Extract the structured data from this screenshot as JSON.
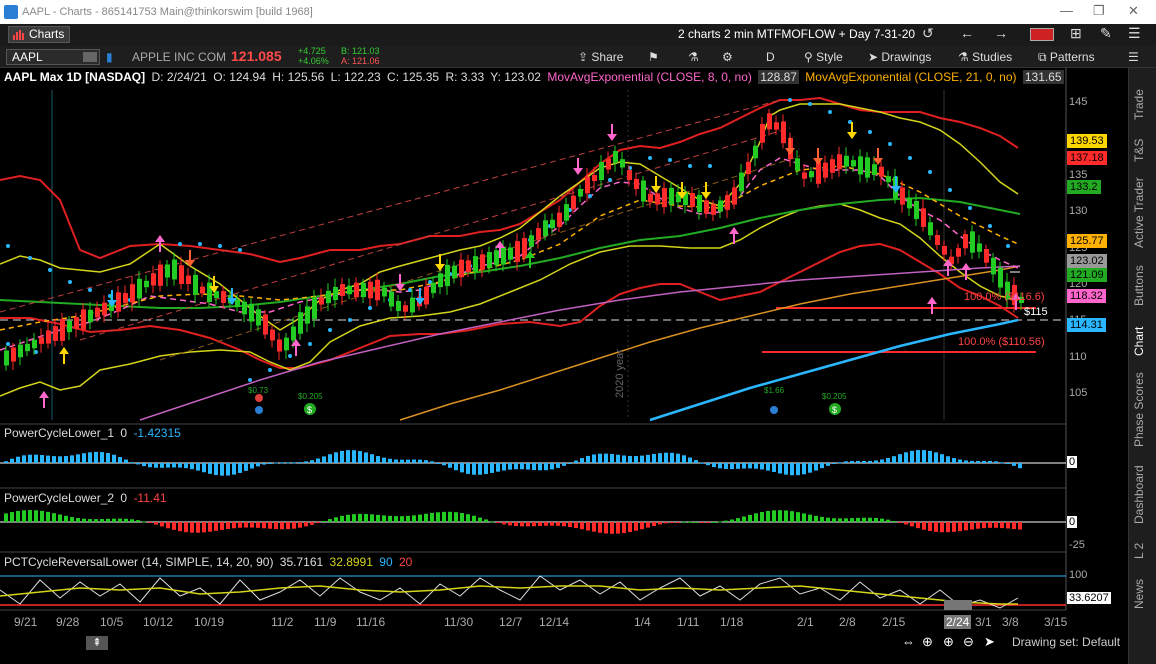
{
  "window": {
    "title": "AAPL - Charts - 865141753 Main@thinkorswim [build 1968]"
  },
  "tabbar": {
    "charts_label": "Charts",
    "layout_name": "2 charts 2 min MTFMOFLOW + Day 7-31-20"
  },
  "toolbar": {
    "symbol": "AAPL",
    "company": "APPLE INC COM",
    "last": "121.085",
    "net_change": "+4.725",
    "pct_change": "+4.06%",
    "bid": "B: 121.03",
    "ask": "A: 121.06",
    "share": "Share",
    "period": "D",
    "style": "Style",
    "drawings": "Drawings",
    "studies": "Studies",
    "patterns": "Patterns"
  },
  "header": {
    "title": "AAPL Max 1D [NASDAQ]",
    "date": "D: 2/24/21",
    "open": "O: 124.94",
    "high": "H: 125.56",
    "low": "L: 122.23",
    "close": "C: 125.35",
    "range": "R: 3.33",
    "y": "Y: 123.02",
    "ema8_label": "MovAvgExponential (CLOSE, 8, 0, no)",
    "ema8_value": "128.87",
    "ema21_label": "MovAvgExponential (CLOSE, 21, 0, no)",
    "ema21_value": "131.65"
  },
  "price_axis": {
    "ticks": [
      "145",
      "140",
      "135",
      "130",
      "125",
      "120",
      "115",
      "110",
      "105"
    ]
  },
  "price_tags": [
    {
      "value": "139.53",
      "color": "#ffd700",
      "text": "#000000"
    },
    {
      "value": "137.18",
      "color": "#ff2a2a",
      "text": "#000000"
    },
    {
      "value": "133.2",
      "color": "#22aa22",
      "text": "#000000"
    },
    {
      "value": "125.77",
      "color": "#ffb000",
      "text": "#000000"
    },
    {
      "value": "123.02",
      "color": "#999999",
      "text": "#000000"
    },
    {
      "value": "121.09",
      "color": "#22aa22",
      "text": "#000000"
    },
    {
      "value": "118.32",
      "color": "#ff66cc",
      "text": "#000000"
    },
    {
      "value": "114.31",
      "color": "#2ab7ff",
      "text": "#000000"
    }
  ],
  "annotations": {
    "fib1": "100.0% ($116.6)",
    "fib2": "100.0% ($110.56)",
    "level_115": "$115",
    "year_label": "2020 year",
    "div1": "$0.73",
    "div2": "$0.205",
    "div3": "$1.66",
    "div4": "$0.205"
  },
  "studies": {
    "pc1_label": "PowerCycleLower_1",
    "pc1_flag": "0",
    "pc1_value": "-1.42315",
    "pc1_zero": "0",
    "pc2_label": "PowerCycleLower_2",
    "pc2_flag": "0",
    "pc2_value": "-11.41",
    "pc2_zero": "0",
    "pc2_tick": "-25",
    "pct_label": "PCTCycleReversalLower (14, SIMPLE, 14, 20, 90)",
    "pct_v1": "35.7161",
    "pct_v2": "32.8991",
    "pct_v3": "90",
    "pct_v4": "20",
    "pct_100": "100",
    "pct_tag": "33.6207"
  },
  "x_axis": {
    "ticks": [
      "9/21",
      "9/28",
      "10/5",
      "10/12",
      "10/19",
      "11/2",
      "11/9",
      "11/16",
      "11/30",
      "12/7",
      "12/14",
      "1/4",
      "1/11",
      "1/18",
      "2/1",
      "2/8",
      "2/15",
      "2/24",
      "3/1",
      "3/8",
      "3/15"
    ]
  },
  "sidebar": {
    "tabs": [
      "Trade",
      "T&S",
      "Active Trader",
      "Buttons",
      "Chart",
      "Phase Scores",
      "Dashboard",
      "L 2",
      "News"
    ]
  },
  "statusbar": {
    "drawing_set": "Drawing set: Default"
  }
}
